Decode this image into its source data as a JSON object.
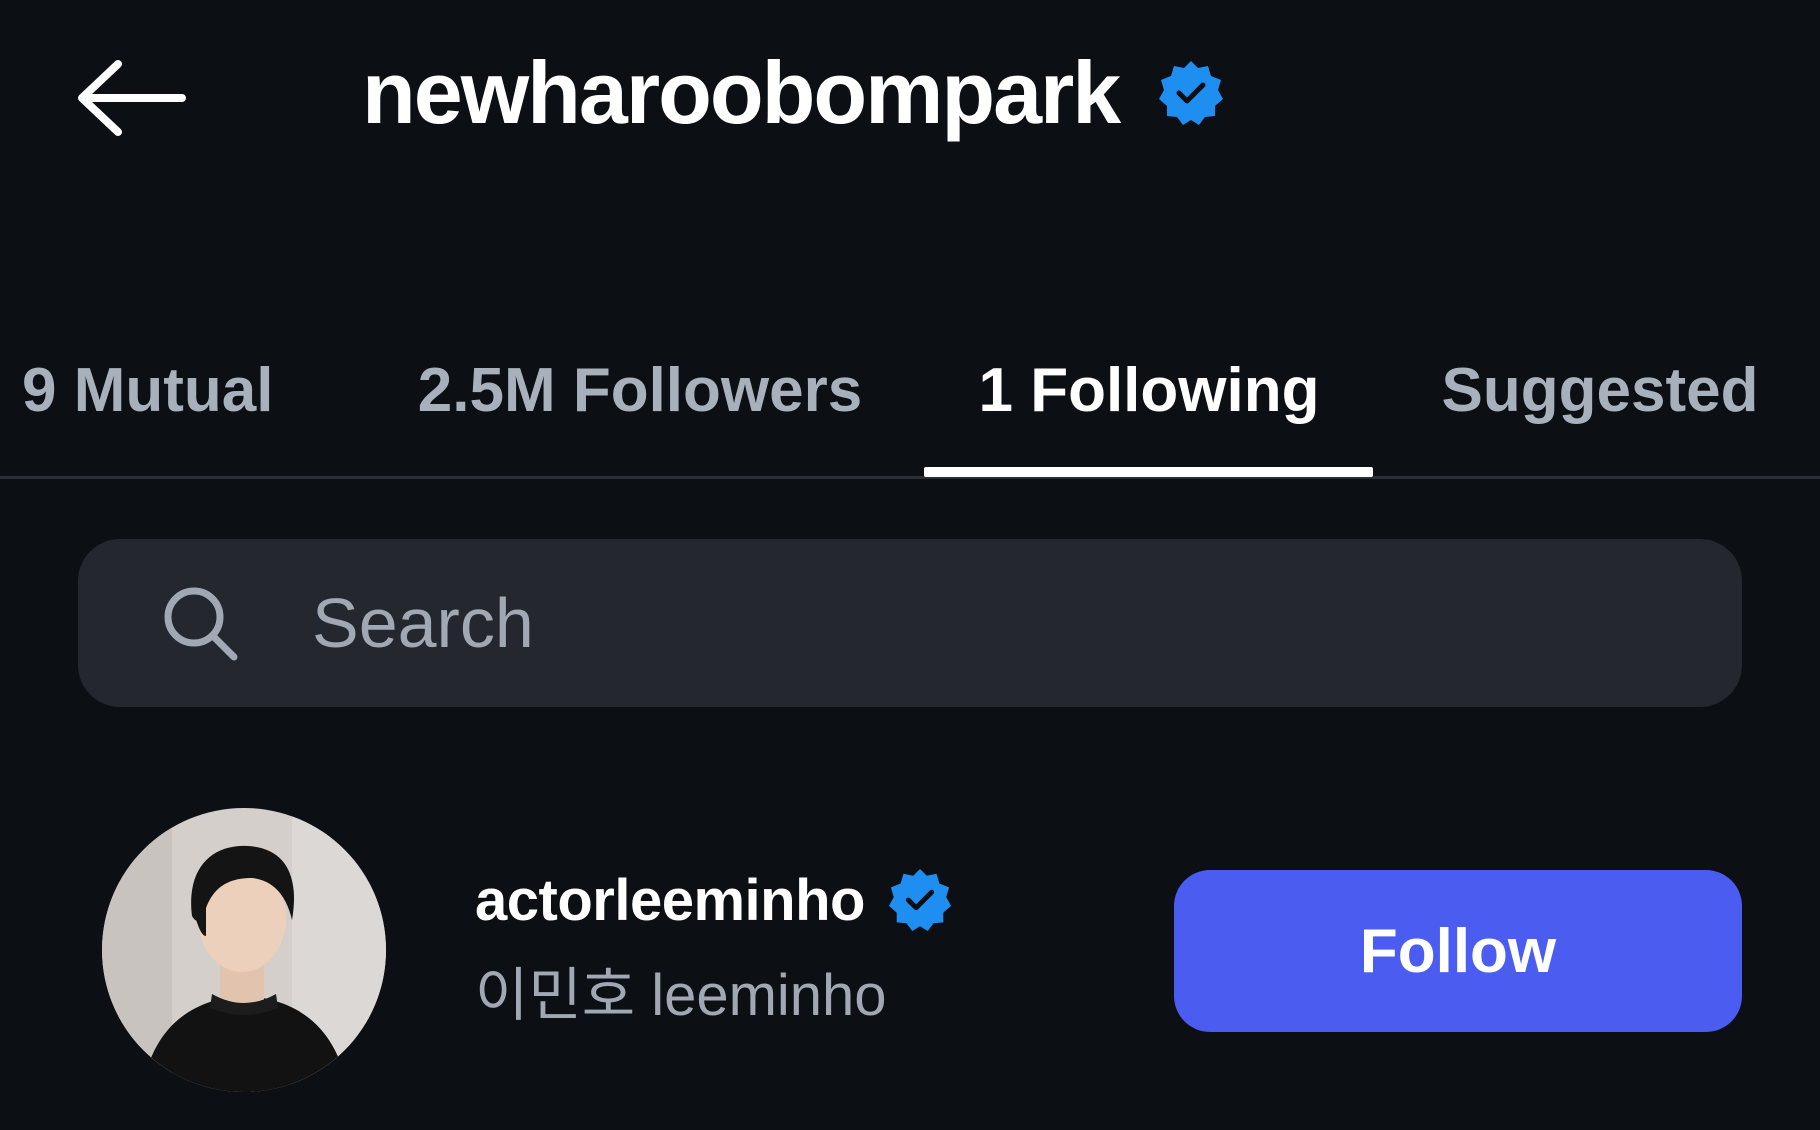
{
  "header": {
    "title": "newharoobompark",
    "back_icon": "arrow-left-icon",
    "verified_icon": "verified-badge-icon",
    "verified_color": "#1f8ef1"
  },
  "tabs": [
    {
      "label": "9 Mutual",
      "active": false
    },
    {
      "label": "2.5M Followers",
      "active": false
    },
    {
      "label": "1 Following",
      "active": true
    },
    {
      "label": "Suggested",
      "active": false
    }
  ],
  "search": {
    "placeholder": "Search",
    "value": "",
    "icon": "search-icon"
  },
  "list": [
    {
      "username": "actorleeminho",
      "full_name": "이민호 leeminho",
      "verified": true,
      "button_label": "Follow"
    }
  ],
  "colors": {
    "background": "#0c0f14",
    "search_background": "#24272d",
    "follow_button": "#4b5cf0",
    "muted_text": "#a1a8b3"
  }
}
